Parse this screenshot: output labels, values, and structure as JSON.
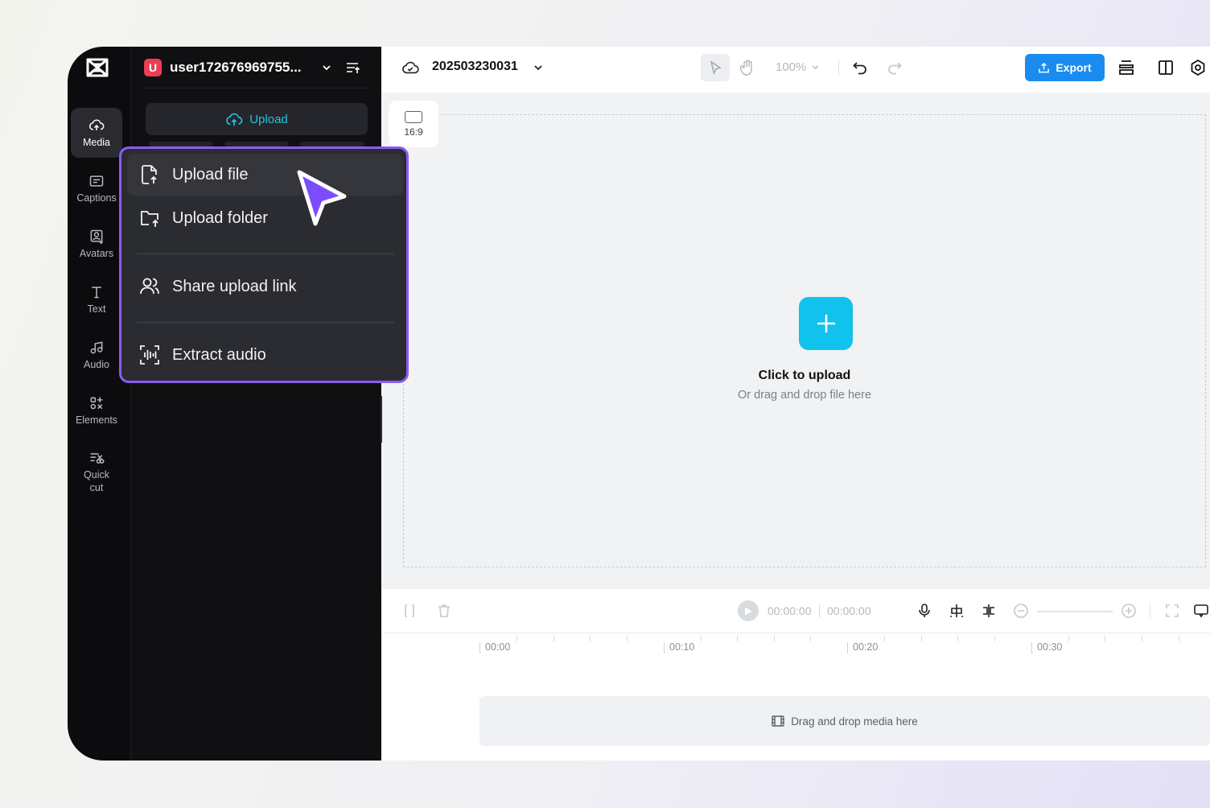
{
  "user": {
    "badge": "U",
    "name": "user172676969755..."
  },
  "rail": {
    "items": [
      {
        "label": "Media",
        "icon": "cloud-upload-icon"
      },
      {
        "label": "Captions",
        "icon": "captions-icon"
      },
      {
        "label": "Avatars",
        "icon": "avatar-icon"
      },
      {
        "label": "Text",
        "icon": "text-icon"
      },
      {
        "label": "Audio",
        "icon": "music-note-icon"
      },
      {
        "label": "Elements",
        "icon": "elements-icon"
      },
      {
        "label": "Quick",
        "label2": "cut",
        "icon": "quick-cut-icon"
      }
    ]
  },
  "panel": {
    "upload_label": "Upload"
  },
  "menu": {
    "items": [
      {
        "label": "Upload file",
        "icon": "upload-file-icon"
      },
      {
        "label": "Upload folder",
        "icon": "upload-folder-icon"
      },
      {
        "label": "Share upload link",
        "icon": "users-icon"
      },
      {
        "label": "Extract audio",
        "icon": "extract-audio-icon"
      }
    ]
  },
  "toolbar": {
    "project_name": "202503230031",
    "zoom": "100%",
    "export_label": "Export"
  },
  "canvas": {
    "ratio": "16:9",
    "click_to_upload": "Click to upload",
    "drag_drop_hint": "Or drag and drop file here"
  },
  "timeline": {
    "current_time": "00:00:00",
    "total_time": "00:00:00",
    "ruler_labels": [
      "00:00",
      "00:10",
      "00:20",
      "00:30"
    ],
    "track_hint": "Drag and drop media here"
  },
  "colors": {
    "accent_cyan": "#11c2ec",
    "export_blue": "#1a8cf0",
    "menu_highlight": "#8b5cf6",
    "user_badge": "#ea3f52"
  }
}
